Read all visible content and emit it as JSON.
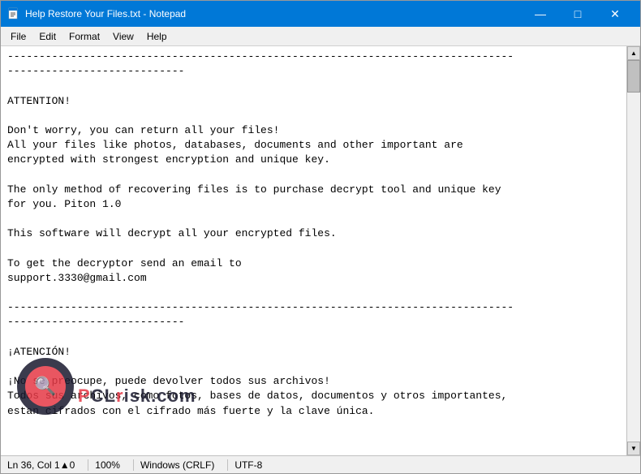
{
  "window": {
    "title": "Help Restore Your Files.txt - Notepad",
    "icon": "📄"
  },
  "titlebar": {
    "title": "Help Restore Your Files.txt - Notepad",
    "minimize": "—",
    "maximize": "□",
    "close": "✕"
  },
  "menubar": {
    "items": [
      "File",
      "Edit",
      "Format",
      "View",
      "Help"
    ]
  },
  "content": {
    "text": "--------------------------------------------------------------------------------\n----------------------------\n\nATTENTION!\n\nDon't worry, you can return all your files!\nAll your files like photos, databases, documents and other important are\nencrypted with strongest encryption and unique key.\n\nThe only method of recovering files is to purchase decrypt tool and unique key\nfor you. Piton 1.0\n\nThis software will decrypt all your encrypted files.\n\nTo get the decryptor send an email to\nsupport.3330@gmail.com\n\n--------------------------------------------------------------------------------\n----------------------------\n\n¡ATENCIÓN!\n\n¡No se preocupe, puede devolver todos sus archivos!\nTodos sus archivos, como fotos, bases de datos, documentos y otros importantes,\nestan cifrados con el cifrado más fuerte y la clave única."
  },
  "statusbar": {
    "position": "Ln 36, Col 1▲0",
    "zoom": "100%",
    "lineending": "Windows (CRLF)",
    "encoding": "UTF-8"
  },
  "watermark": {
    "text": "risk.com",
    "highlight": "P",
    "symbol": "🔍"
  }
}
